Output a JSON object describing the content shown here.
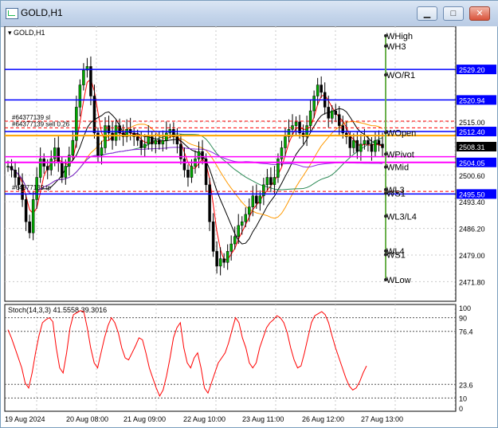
{
  "window": {
    "title": "GOLD,H1",
    "minimize_icon": "minimize-icon",
    "maximize_icon": "maximize-icon",
    "close_icon": "close-icon"
  },
  "colors": {
    "background": "#ffffff",
    "blue_line": "#0000ff",
    "magenta_line": "#ff00ff",
    "orange_line": "#ffa500",
    "candle_green": "#00aa00",
    "candle_black": "#000000",
    "stoch": "#ff0000"
  },
  "chart_data": [
    {
      "type": "candlestick",
      "symbol_label": "GOLD,H1",
      "y_ticks": [
        "2515.00",
        "2500.60",
        "2493.40",
        "2486.20",
        "2479.00",
        "2471.80"
      ],
      "y_ticks_values": [
        2515.0,
        2500.6,
        2493.4,
        2486.2,
        2479.0,
        2471.8
      ],
      "ylim": [
        2468.0,
        2540.0
      ],
      "price_boxes": [
        {
          "label": "2529.20",
          "value": 2529.2,
          "color": "#0000ff"
        },
        {
          "label": "2520.94",
          "value": 2520.94,
          "color": "#0000ff"
        },
        {
          "label": "2512.40",
          "value": 2512.4,
          "color": "#0000ff"
        },
        {
          "label": "2508.31",
          "value": 2508.31,
          "color": "#000000"
        },
        {
          "label": "2504.05",
          "value": 2504.05,
          "color": "#0000ff"
        },
        {
          "label": "2495.50",
          "value": 2495.5,
          "color": "#0000ff"
        }
      ],
      "levels": [
        {
          "name": "WHigh",
          "value": 2538.3
        },
        {
          "name": "WH3",
          "value": 2535.5
        },
        {
          "name": "WO/R1",
          "value": 2527.7
        },
        {
          "name": "WOpen",
          "value": 2512.1
        },
        {
          "name": "WPivot",
          "value": 2506.3
        },
        {
          "name": "WMid",
          "value": 2502.8
        },
        {
          "name": "WL3",
          "value": 2496.7
        },
        {
          "name": "WS1",
          "value": 2495.7
        },
        {
          "name": "WL3/L4",
          "value": 2489.5
        },
        {
          "name": "WL4",
          "value": 2480.1
        },
        {
          "name": "WS1",
          "value": 2479.1
        },
        {
          "name": "WLow",
          "value": 2472.3
        }
      ],
      "order_labels": [
        {
          "text": "#64377139 sl",
          "value": 2515.2
        },
        {
          "text": "#64377139 sell 0.26",
          "value": 2513.4
        },
        {
          "text": "#64377139 tp",
          "value": 2496.2
        }
      ],
      "x_tick_labels": [
        "19 Aug 2024",
        "20 Aug 08:00",
        "21 Aug 09:00",
        "22 Aug 10:00",
        "23 Aug 11:00",
        "26 Aug 12:00",
        "27 Aug 13:00"
      ],
      "close_path": [
        2503,
        2502,
        2500,
        2498,
        2494,
        2488,
        2485,
        2494,
        2500,
        2505,
        2503,
        2502,
        2505,
        2508,
        2504,
        2500,
        2503,
        2506,
        2510,
        2519,
        2525,
        2529,
        2530,
        2522,
        2512,
        2506,
        2508,
        2514,
        2512,
        2510,
        2514,
        2512,
        2511,
        2513,
        2512,
        2511,
        2510,
        2508,
        2509,
        2511,
        2509,
        2510,
        2509,
        2510,
        2512,
        2513,
        2511,
        2509,
        2505,
        2502,
        2500,
        2503,
        2505,
        2507,
        2505,
        2498,
        2488,
        2480,
        2476,
        2478,
        2477,
        2480,
        2482,
        2484,
        2487,
        2488,
        2490,
        2492,
        2495,
        2493,
        2495,
        2498,
        2500,
        2498,
        2500,
        2505,
        2508,
        2511,
        2513,
        2514,
        2515,
        2512,
        2511,
        2514,
        2518,
        2522,
        2525,
        2523,
        2519,
        2516,
        2518,
        2517,
        2514,
        2512,
        2511,
        2508,
        2510,
        2507,
        2509,
        2510,
        2509,
        2507,
        2510,
        2509,
        2508
      ]
    },
    {
      "type": "line",
      "title": "Stoch(14,3,3) 41.5558 39.3016",
      "y_ticks": [
        "100",
        "90",
        "76.4",
        "23.6",
        "10",
        "0"
      ],
      "ylim": [
        0,
        100
      ],
      "main_values": [
        78,
        70,
        60,
        50,
        40,
        25,
        20,
        35,
        55,
        72,
        85,
        88,
        90,
        86,
        60,
        40,
        35,
        55,
        80,
        93,
        95,
        97,
        96,
        80,
        60,
        45,
        40,
        55,
        70,
        82,
        90,
        85,
        75,
        60,
        50,
        48,
        55,
        62,
        70,
        68,
        55,
        40,
        30,
        20,
        12,
        18,
        32,
        50,
        70,
        80,
        85,
        60,
        45,
        40,
        50,
        55,
        40,
        20,
        15,
        25,
        35,
        45,
        50,
        55,
        65,
        78,
        90,
        85,
        70,
        60,
        45,
        40,
        45,
        60,
        70,
        80,
        85,
        88,
        92,
        90,
        85,
        75,
        60,
        48,
        40,
        42,
        55,
        70,
        85,
        92,
        94,
        96,
        93,
        85,
        72,
        60,
        50,
        40,
        30,
        22,
        18,
        20,
        26,
        35,
        42
      ]
    }
  ]
}
